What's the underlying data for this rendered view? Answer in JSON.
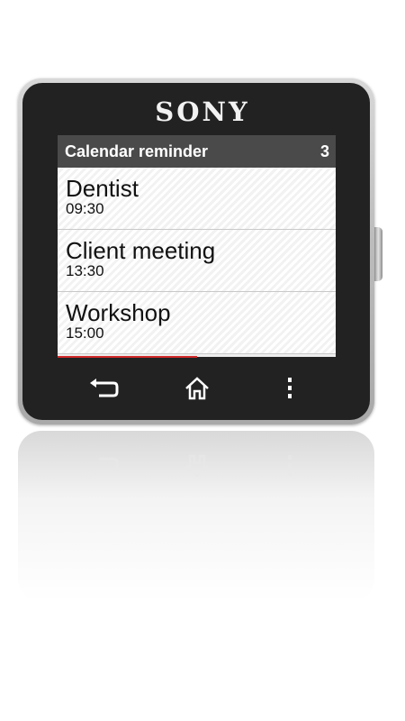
{
  "device": {
    "brand": "SONY"
  },
  "app": {
    "title": "Calendar reminder",
    "count": "3",
    "reminders": [
      {
        "name": "Dentist",
        "time": "09:30"
      },
      {
        "name": "Client meeting",
        "time": "13:30"
      },
      {
        "name": "Workshop",
        "time": "15:00"
      }
    ],
    "scroll_progress": 0.5
  },
  "nav": {
    "icons": [
      "back-icon",
      "home-icon",
      "menu-icon"
    ]
  },
  "colors": {
    "titlebar": "#4a4a4a",
    "accent_indicator": "#d0282a",
    "bezel": "#222222"
  }
}
